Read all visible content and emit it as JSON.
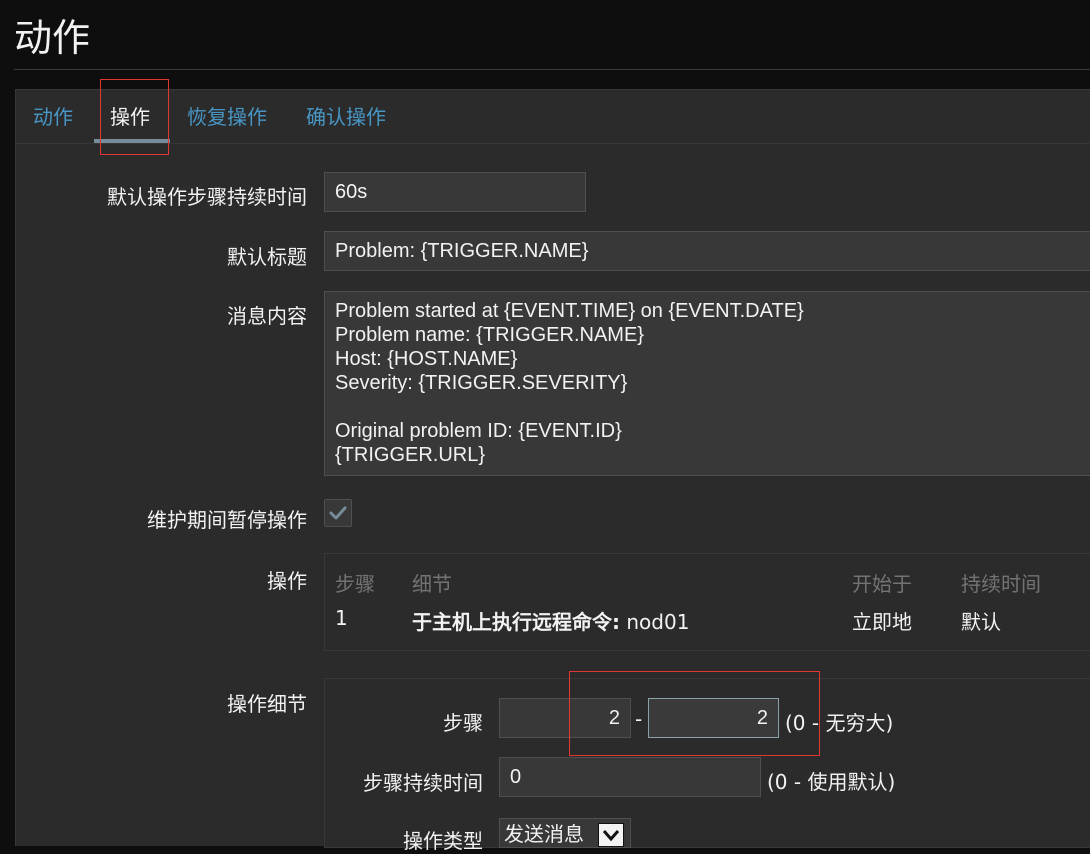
{
  "page": {
    "title": "动作"
  },
  "tabs": [
    {
      "label": "动作",
      "active": false
    },
    {
      "label": "操作",
      "active": true
    },
    {
      "label": "恢复操作",
      "active": false
    },
    {
      "label": "确认操作",
      "active": false
    }
  ],
  "form": {
    "default_step_duration": {
      "label": "默认操作步骤持续时间",
      "value": "60s"
    },
    "default_subject": {
      "label": "默认标题",
      "value": "Problem: {TRIGGER.NAME}"
    },
    "message": {
      "label": "消息内容",
      "lines": [
        "Problem started at {EVENT.TIME} on {EVENT.DATE}",
        "Problem name: {TRIGGER.NAME}",
        "Host: {HOST.NAME}",
        "Severity: {TRIGGER.SEVERITY}",
        "",
        "Original problem ID: {EVENT.ID}",
        "{TRIGGER.URL}"
      ]
    },
    "pause_in_maintenance": {
      "label": "维护期间暂停操作",
      "checked": true
    },
    "operations": {
      "label": "操作",
      "headers": {
        "step": "步骤",
        "details": "细节",
        "start_in": "开始于",
        "duration": "持续时间"
      },
      "rows": [
        {
          "step": "1",
          "details_bold": "于主机上执行远程命令:",
          "details_rest": " nod01",
          "start_in": "立即地",
          "duration": "默认"
        }
      ]
    },
    "operation_details": {
      "label": "操作细节",
      "steps": {
        "label": "步骤",
        "from": "2",
        "separator": "-",
        "to": "2",
        "hint": "(0 - 无穷大)"
      },
      "step_duration": {
        "label": "步骤持续时间",
        "value": "0",
        "hint": "(0 - 使用默认)"
      },
      "operation_type": {
        "label": "操作类型",
        "value": "发送消息"
      }
    }
  },
  "colors": {
    "link": "#4796c4",
    "highlight": "#e33734",
    "background": "#0e0e0e",
    "panel": "#2b2b2b"
  },
  "icons": {
    "checkbox": "check-icon",
    "select": "chevron-down-icon"
  }
}
